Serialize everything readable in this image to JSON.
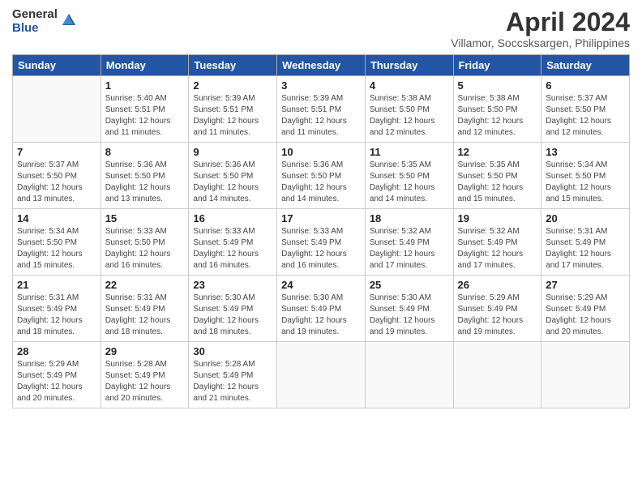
{
  "logo": {
    "general": "General",
    "blue": "Blue"
  },
  "title": "April 2024",
  "subtitle": "Villamor, Soccsksargen, Philippines",
  "headers": [
    "Sunday",
    "Monday",
    "Tuesday",
    "Wednesday",
    "Thursday",
    "Friday",
    "Saturday"
  ],
  "weeks": [
    [
      {
        "day": "",
        "info": ""
      },
      {
        "day": "1",
        "info": "Sunrise: 5:40 AM\nSunset: 5:51 PM\nDaylight: 12 hours\nand 11 minutes."
      },
      {
        "day": "2",
        "info": "Sunrise: 5:39 AM\nSunset: 5:51 PM\nDaylight: 12 hours\nand 11 minutes."
      },
      {
        "day": "3",
        "info": "Sunrise: 5:39 AM\nSunset: 5:51 PM\nDaylight: 12 hours\nand 11 minutes."
      },
      {
        "day": "4",
        "info": "Sunrise: 5:38 AM\nSunset: 5:50 PM\nDaylight: 12 hours\nand 12 minutes."
      },
      {
        "day": "5",
        "info": "Sunrise: 5:38 AM\nSunset: 5:50 PM\nDaylight: 12 hours\nand 12 minutes."
      },
      {
        "day": "6",
        "info": "Sunrise: 5:37 AM\nSunset: 5:50 PM\nDaylight: 12 hours\nand 12 minutes."
      }
    ],
    [
      {
        "day": "7",
        "info": "Sunrise: 5:37 AM\nSunset: 5:50 PM\nDaylight: 12 hours\nand 13 minutes."
      },
      {
        "day": "8",
        "info": "Sunrise: 5:36 AM\nSunset: 5:50 PM\nDaylight: 12 hours\nand 13 minutes."
      },
      {
        "day": "9",
        "info": "Sunrise: 5:36 AM\nSunset: 5:50 PM\nDaylight: 12 hours\nand 14 minutes."
      },
      {
        "day": "10",
        "info": "Sunrise: 5:36 AM\nSunset: 5:50 PM\nDaylight: 12 hours\nand 14 minutes."
      },
      {
        "day": "11",
        "info": "Sunrise: 5:35 AM\nSunset: 5:50 PM\nDaylight: 12 hours\nand 14 minutes."
      },
      {
        "day": "12",
        "info": "Sunrise: 5:35 AM\nSunset: 5:50 PM\nDaylight: 12 hours\nand 15 minutes."
      },
      {
        "day": "13",
        "info": "Sunrise: 5:34 AM\nSunset: 5:50 PM\nDaylight: 12 hours\nand 15 minutes."
      }
    ],
    [
      {
        "day": "14",
        "info": "Sunrise: 5:34 AM\nSunset: 5:50 PM\nDaylight: 12 hours\nand 15 minutes."
      },
      {
        "day": "15",
        "info": "Sunrise: 5:33 AM\nSunset: 5:50 PM\nDaylight: 12 hours\nand 16 minutes."
      },
      {
        "day": "16",
        "info": "Sunrise: 5:33 AM\nSunset: 5:49 PM\nDaylight: 12 hours\nand 16 minutes."
      },
      {
        "day": "17",
        "info": "Sunrise: 5:33 AM\nSunset: 5:49 PM\nDaylight: 12 hours\nand 16 minutes."
      },
      {
        "day": "18",
        "info": "Sunrise: 5:32 AM\nSunset: 5:49 PM\nDaylight: 12 hours\nand 17 minutes."
      },
      {
        "day": "19",
        "info": "Sunrise: 5:32 AM\nSunset: 5:49 PM\nDaylight: 12 hours\nand 17 minutes."
      },
      {
        "day": "20",
        "info": "Sunrise: 5:31 AM\nSunset: 5:49 PM\nDaylight: 12 hours\nand 17 minutes."
      }
    ],
    [
      {
        "day": "21",
        "info": "Sunrise: 5:31 AM\nSunset: 5:49 PM\nDaylight: 12 hours\nand 18 minutes."
      },
      {
        "day": "22",
        "info": "Sunrise: 5:31 AM\nSunset: 5:49 PM\nDaylight: 12 hours\nand 18 minutes."
      },
      {
        "day": "23",
        "info": "Sunrise: 5:30 AM\nSunset: 5:49 PM\nDaylight: 12 hours\nand 18 minutes."
      },
      {
        "day": "24",
        "info": "Sunrise: 5:30 AM\nSunset: 5:49 PM\nDaylight: 12 hours\nand 19 minutes."
      },
      {
        "day": "25",
        "info": "Sunrise: 5:30 AM\nSunset: 5:49 PM\nDaylight: 12 hours\nand 19 minutes."
      },
      {
        "day": "26",
        "info": "Sunrise: 5:29 AM\nSunset: 5:49 PM\nDaylight: 12 hours\nand 19 minutes."
      },
      {
        "day": "27",
        "info": "Sunrise: 5:29 AM\nSunset: 5:49 PM\nDaylight: 12 hours\nand 20 minutes."
      }
    ],
    [
      {
        "day": "28",
        "info": "Sunrise: 5:29 AM\nSunset: 5:49 PM\nDaylight: 12 hours\nand 20 minutes."
      },
      {
        "day": "29",
        "info": "Sunrise: 5:28 AM\nSunset: 5:49 PM\nDaylight: 12 hours\nand 20 minutes."
      },
      {
        "day": "30",
        "info": "Sunrise: 5:28 AM\nSunset: 5:49 PM\nDaylight: 12 hours\nand 21 minutes."
      },
      {
        "day": "",
        "info": ""
      },
      {
        "day": "",
        "info": ""
      },
      {
        "day": "",
        "info": ""
      },
      {
        "day": "",
        "info": ""
      }
    ]
  ]
}
